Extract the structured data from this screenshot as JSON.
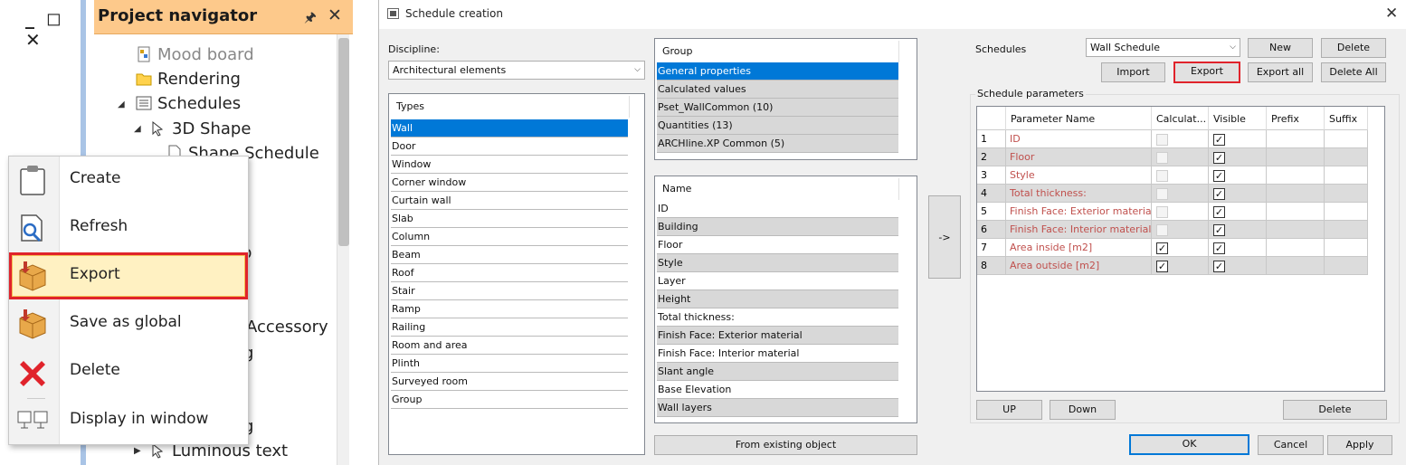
{
  "window_controls": "_ ◻ ✕",
  "project_navigator": {
    "title": "Project navigator",
    "pin_icon": "pin-icon",
    "close_icon": "close-icon",
    "tree": [
      {
        "label": "Mood board",
        "icon": "mood-board-icon",
        "disabled": true
      },
      {
        "label": "Rendering",
        "icon": "folder-icon"
      },
      {
        "label": "Schedules",
        "icon": "schedules-icon"
      },
      {
        "label": "3D Shape",
        "icon": "3d-shape-icon"
      },
      {
        "label": "Shape Schedule",
        "icon": "document-icon"
      }
    ],
    "partial_labels": [
      "p",
      "Accessory",
      "g",
      "g",
      "Luminous text"
    ]
  },
  "context_menu": {
    "items": [
      {
        "label": "Create",
        "icon": "clipboard-icon"
      },
      {
        "label": "Refresh",
        "icon": "refresh-icon"
      },
      {
        "label": "Export",
        "icon": "export-box-icon"
      },
      {
        "label": "Save as global",
        "icon": "save-global-box-icon"
      },
      {
        "label": "Delete",
        "icon": "delete-x-icon"
      },
      {
        "label": "Display in window",
        "icon": "display-window-icon"
      }
    ],
    "highlight_color": "#e0232b"
  },
  "dialog": {
    "title": "Schedule creation",
    "discipline_label": "Discipline:",
    "discipline_value": "Architectural elements",
    "types_header": "Types",
    "types": [
      "Wall",
      "Door",
      "Window",
      "Corner window",
      "Curtain wall",
      "Slab",
      "Column",
      "Beam",
      "Roof",
      "Stair",
      "Ramp",
      "Railing",
      "Room and area",
      "Plinth",
      "Surveyed room",
      "Group"
    ],
    "group_header": "Group",
    "groups": [
      "General properties",
      "Calculated values",
      "Pset_WallCommon (10)",
      "Quantities (13)",
      "ARCHline.XP Common (5)"
    ],
    "name_header": "Name",
    "names": [
      "ID",
      "Building",
      "Floor",
      "Style",
      "Layer",
      "Height",
      "Total thickness:",
      "Finish Face: Exterior material",
      "Finish Face: Interior material",
      "Slant angle",
      "Base Elevation",
      "Wall layers"
    ],
    "from_existing_label": "From existing object",
    "arrow_label": "->",
    "schedules_label": "Schedules",
    "schedule_value": "Wall Schedule",
    "buttons": {
      "new": "New",
      "delete_top": "Delete",
      "import": "Import",
      "export": "Export",
      "export_all": "Export all",
      "delete_all": "Delete All",
      "up": "UP",
      "down": "Down",
      "delete_bottom": "Delete",
      "ok": "OK",
      "cancel": "Cancel",
      "apply": "Apply"
    },
    "schedule_parameters_label": "Schedule parameters",
    "param_columns": [
      "Parameter Name",
      "Calculat...",
      "Visible",
      "Prefix",
      "Suffix"
    ],
    "params": [
      {
        "num": "1",
        "name": "ID",
        "calculated": false,
        "calc_enabled": false,
        "visible": true
      },
      {
        "num": "2",
        "name": "Floor",
        "calculated": false,
        "calc_enabled": false,
        "visible": true
      },
      {
        "num": "3",
        "name": "Style",
        "calculated": false,
        "calc_enabled": false,
        "visible": true
      },
      {
        "num": "4",
        "name": "Total thickness:",
        "calculated": false,
        "calc_enabled": false,
        "visible": true
      },
      {
        "num": "5",
        "name": "Finish Face: Exterior material",
        "calculated": false,
        "calc_enabled": false,
        "visible": true
      },
      {
        "num": "6",
        "name": "Finish Face: Interior material",
        "calculated": false,
        "calc_enabled": false,
        "visible": true
      },
      {
        "num": "7",
        "name": "Area inside [m2]",
        "calculated": true,
        "calc_enabled": true,
        "visible": true
      },
      {
        "num": "8",
        "name": "Area outside [m2]",
        "calculated": true,
        "calc_enabled": true,
        "visible": true
      }
    ],
    "colors": {
      "selection": "#0078d7",
      "param_text": "#c0504d",
      "highlight": "#e0232b"
    }
  }
}
